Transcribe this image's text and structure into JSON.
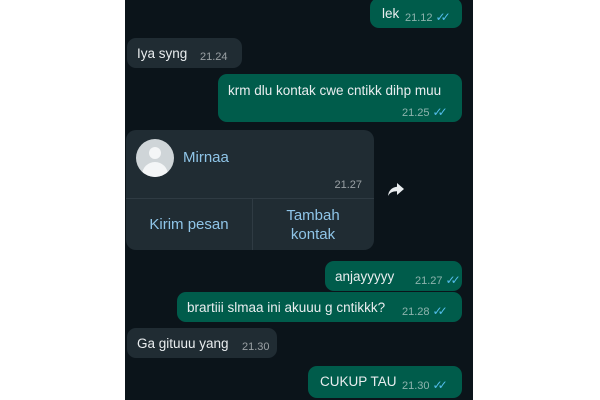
{
  "messages": [
    {
      "id": "m1",
      "direction": "outgoing",
      "text": "lek",
      "time": "21.12",
      "read": true
    },
    {
      "id": "m2",
      "direction": "incoming",
      "text": "Iya syng",
      "time": "21.24"
    },
    {
      "id": "m3",
      "direction": "outgoing",
      "text": "krm dlu kontak cwe cntikk dihp muu",
      "time": "21.25",
      "read": true
    },
    {
      "id": "m5",
      "direction": "outgoing",
      "text": "anjayyyyy",
      "time": "21.27",
      "read": true
    },
    {
      "id": "m6",
      "direction": "outgoing",
      "text": "brartiii slmaa ini akuuu g cntikkk?",
      "time": "21.28",
      "read": true
    },
    {
      "id": "m7",
      "direction": "incoming",
      "text": "Ga gituuu yang",
      "time": "21.30"
    },
    {
      "id": "m8",
      "direction": "outgoing",
      "text": "CUKUP TAU",
      "time": "21.30",
      "read": true
    }
  ],
  "contact_card": {
    "name": "Mirnaa",
    "time": "21.27",
    "send_label": "Kirim pesan",
    "add_label": "Tambah kontak"
  },
  "icons": {
    "read_receipt": "double-check-icon",
    "forward": "forward-icon",
    "avatar": "default-avatar-icon"
  },
  "colors": {
    "background": "#0b141a",
    "outgoing_bubble": "#005c4b",
    "incoming_bubble": "#202c33",
    "read_tick": "#53bdeb",
    "link": "#8fc5e8"
  }
}
